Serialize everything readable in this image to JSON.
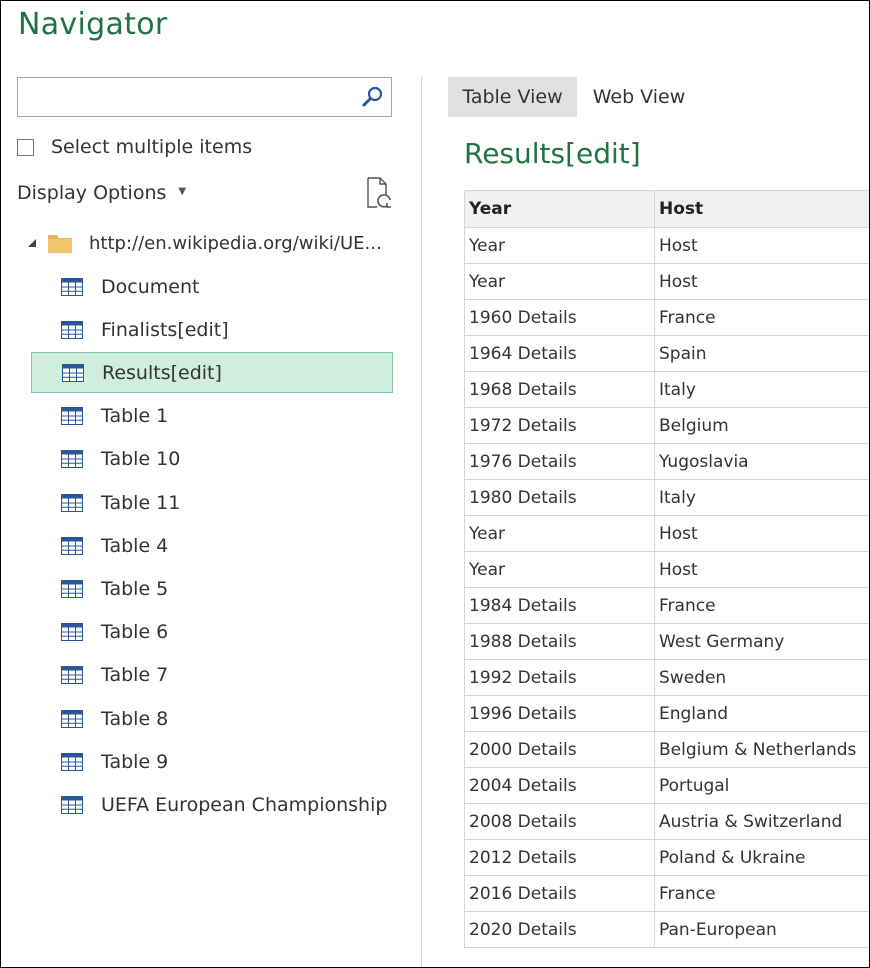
{
  "window": {
    "title": "Navigator"
  },
  "search": {
    "value": "",
    "placeholder": ""
  },
  "select_multiple": {
    "label": "Select multiple items",
    "checked": false
  },
  "display_options": {
    "label": "Display Options"
  },
  "tree": {
    "root": {
      "label": "http://en.wikipedia.org/wiki/UE..."
    },
    "items": [
      {
        "label": "Document",
        "selected": false
      },
      {
        "label": "Finalists[edit]",
        "selected": false
      },
      {
        "label": "Results[edit]",
        "selected": true
      },
      {
        "label": "Table 1",
        "selected": false
      },
      {
        "label": "Table 10",
        "selected": false
      },
      {
        "label": "Table 11",
        "selected": false
      },
      {
        "label": "Table 4",
        "selected": false
      },
      {
        "label": "Table 5",
        "selected": false
      },
      {
        "label": "Table 6",
        "selected": false
      },
      {
        "label": "Table 7",
        "selected": false
      },
      {
        "label": "Table 8",
        "selected": false
      },
      {
        "label": "Table 9",
        "selected": false
      },
      {
        "label": "UEFA European Championship",
        "selected": false
      }
    ]
  },
  "tabs": [
    {
      "label": "Table View",
      "active": true
    },
    {
      "label": "Web View",
      "active": false
    }
  ],
  "preview": {
    "title": "Results[edit]",
    "columns": [
      "Year",
      "Host"
    ],
    "rows": [
      [
        "Year",
        "Host"
      ],
      [
        "Year",
        "Host"
      ],
      [
        "1960 Details",
        "France"
      ],
      [
        "1964 Details",
        "Spain"
      ],
      [
        "1968 Details",
        "Italy"
      ],
      [
        "1972 Details",
        "Belgium"
      ],
      [
        "1976 Details",
        "Yugoslavia"
      ],
      [
        "1980 Details",
        "Italy"
      ],
      [
        "Year",
        "Host"
      ],
      [
        "Year",
        "Host"
      ],
      [
        "1984 Details",
        "France"
      ],
      [
        "1988 Details",
        "West Germany"
      ],
      [
        "1992 Details",
        "Sweden"
      ],
      [
        "1996 Details",
        "England"
      ],
      [
        "2000 Details",
        "Belgium & Netherlands"
      ],
      [
        "2004 Details",
        "Portugal"
      ],
      [
        "2008 Details",
        "Austria & Switzerland"
      ],
      [
        "2012 Details",
        "Poland & Ukraine"
      ],
      [
        "2016 Details",
        "France"
      ],
      [
        "2020 Details",
        "Pan-European"
      ]
    ]
  },
  "colors": {
    "accent": "#217346",
    "selection": "#cfeedd",
    "tab_active": "#e1e1e1"
  }
}
